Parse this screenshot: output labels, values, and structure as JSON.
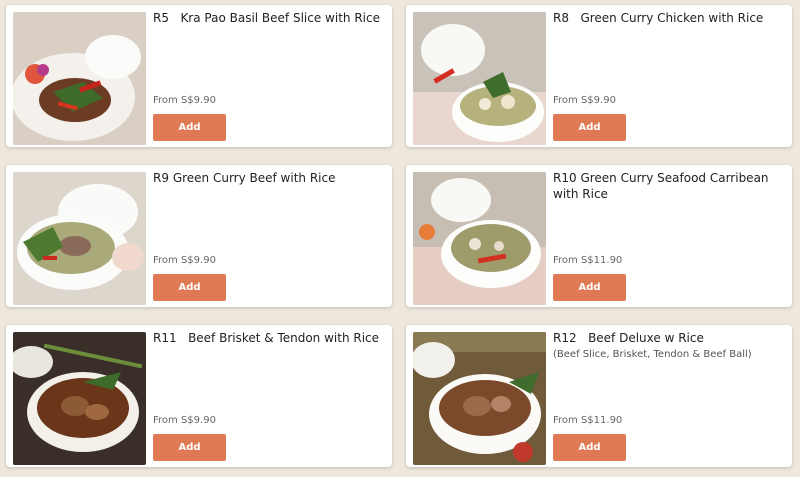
{
  "colors": {
    "background": "#eee7dd",
    "card": "#ffffff",
    "add_button": "#e07a55"
  },
  "items": [
    {
      "code": "R5",
      "name": "Kra Pao Basil Beef Slice with Rice",
      "subtitle": "",
      "price": "From S$9.90",
      "button": "Add",
      "image_icon": "basil-beef-rice-photo"
    },
    {
      "code": "R8",
      "name": "Green Curry Chicken with Rice",
      "subtitle": "",
      "price": "From S$9.90",
      "button": "Add",
      "image_icon": "green-curry-chicken-photo"
    },
    {
      "code": "R9",
      "name": "Green Curry Beef with Rice",
      "subtitle": "",
      "price": "From S$9.90",
      "button": "Add",
      "image_icon": "green-curry-beef-photo"
    },
    {
      "code": "R10",
      "name": "Green Curry Seafood Carribean with Rice",
      "subtitle": "",
      "price": "From S$11.90",
      "button": "Add",
      "image_icon": "green-curry-seafood-photo"
    },
    {
      "code": "R11",
      "name": "Beef Brisket & Tendon with Rice",
      "subtitle": "",
      "price": "From S$9.90",
      "button": "Add",
      "image_icon": "beef-brisket-tendon-photo"
    },
    {
      "code": "R12",
      "name": "Beef Deluxe w Rice",
      "subtitle": "(Beef Slice, Brisket, Tendon & Beef Ball)",
      "price": "From S$11.90",
      "button": "Add",
      "image_icon": "beef-deluxe-photo"
    }
  ]
}
